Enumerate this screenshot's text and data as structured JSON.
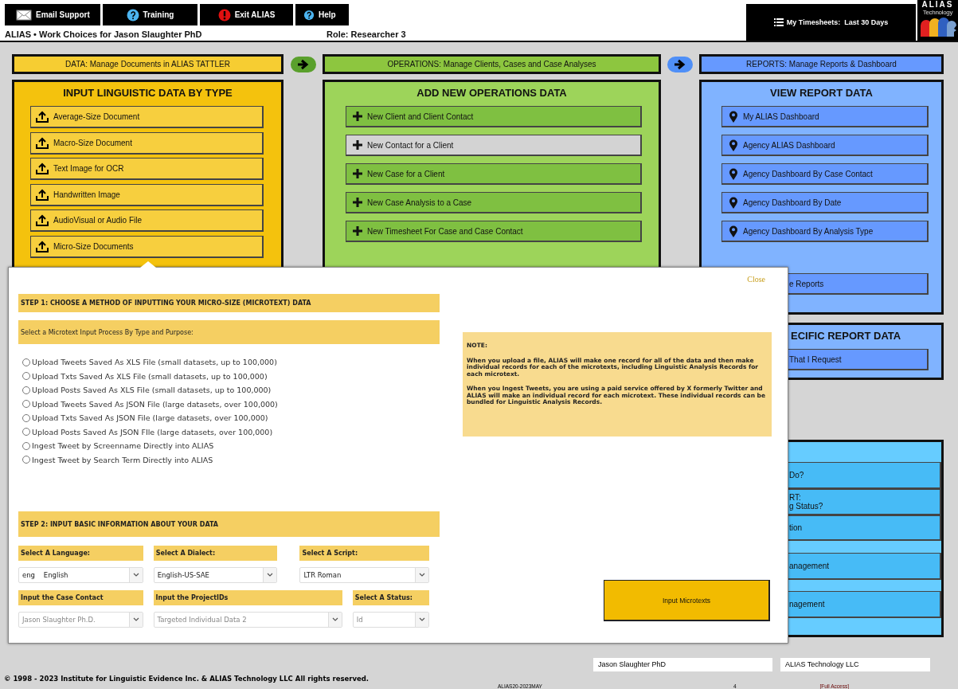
{
  "top_nav": [
    {
      "label": "Email Support",
      "kind": "mail"
    },
    {
      "label": "Training",
      "kind": "question"
    },
    {
      "label": "Exit ALIAS",
      "kind": "alert"
    },
    {
      "label": "Help",
      "kind": "help"
    }
  ],
  "page_title": "ALIAS • Work Choices for Jason Slaughter PhD",
  "role": "Role: Researcher 3",
  "timesheets_button": "My Timesheets:  Last 30 Days",
  "logo": {
    "name": "ALIAS",
    "subtitle": "Technology"
  },
  "columns": [
    {
      "heading": "DATA: Manage Documents in ALIAS TATTLER",
      "color": "#f6cd32",
      "kind": "data",
      "panels": [
        {
          "title": "INPUT LINGUISTIC DATA BY TYPE",
          "color": "#f4c20d",
          "buttons": [
            {
              "label": "Average-Size Document",
              "selected": false
            },
            {
              "label": "Macro-Size Document",
              "selected": false
            },
            {
              "label": "Text Image for OCR",
              "selected": false
            },
            {
              "label": "Handwritten Image",
              "selected": false
            },
            {
              "label": "AudioVisual or Audio File",
              "selected": false
            },
            {
              "label": "Micro-Size Documents",
              "selected": false
            }
          ]
        }
      ]
    },
    {
      "heading": "OPERATIONS: Manage Clients, Cases and Case Analyses",
      "color": "#8dc63f",
      "kind": "operations",
      "panels": [
        {
          "title": "ADD NEW OPERATIONS DATA",
          "color": "#9dd45a",
          "buttons": [
            {
              "label": "New Client and Client Contact",
              "selected": false
            },
            {
              "label": "New Contact for a Client",
              "selected": true
            },
            {
              "label": "New Case for a Client",
              "selected": false
            },
            {
              "label": "New Case Analysis to a Case",
              "selected": false
            },
            {
              "label": "New Timesheet For Case and Case Contact",
              "selected": false
            }
          ]
        }
      ]
    },
    {
      "heading": "REPORTS: Manage Reports & Dashboard",
      "color": "#6699ff",
      "kind": "reports",
      "panels": [
        {
          "title": "VIEW REPORT DATA",
          "color": "#80b3ff",
          "buttons": [
            {
              "label": "My ALIAS Dashboard",
              "selected": false
            },
            {
              "label": "Agency ALIAS Dashboard",
              "selected": false
            },
            {
              "label": "Agency Dashboard By Case Contact",
              "selected": false
            },
            {
              "label": "Agency Dashboard By Date",
              "selected": false
            },
            {
              "label": "Agency Dashboard By Analysis Type",
              "selected": false
            },
            {
              "label": "e Reports",
              "selected": false
            }
          ]
        },
        {
          "title": "ECIFIC REPORT DATA",
          "color": "#80b3ff",
          "buttons": [
            {
              "label": "That I Request",
              "selected": false
            }
          ]
        },
        {
          "color": "#66ccff",
          "buttons": [
            {
              "label": "Do?",
              "selected": false
            },
            {
              "label": "RT:\ng Status?",
              "selected": false
            },
            {
              "label": "tion",
              "selected": false
            },
            {
              "label": "anagement",
              "selected": false
            },
            {
              "label": "nagement",
              "selected": false
            }
          ]
        }
      ]
    }
  ],
  "modal": {
    "close": "Close",
    "step1_title": "STEP 1: CHOOSE A METHOD OF INPUTTING YOUR MICRO-SIZE (MICROTEXT) DATA",
    "step1_subtitle": "Select a Microtext Input Process By Type and Purpose:",
    "options": [
      {
        "label": "Upload Tweets Saved As XLS File (small datasets, up to 100,000)",
        "selected": false
      },
      {
        "label": "Upload Txts Saved As XLS File (small datasets, up to 100,000)",
        "selected": false
      },
      {
        "label": "Upload Posts Saved As XLS File (small datasets, up to 100,000)",
        "selected": false
      },
      {
        "label": "Upload Tweets Saved As JSON File (large datasets, over 100,000)",
        "selected": false
      },
      {
        "label": "Upload Txts Saved As JSON File (large datasets, over 100,000)",
        "selected": false
      },
      {
        "label": "Upload Posts Saved As JSON FIle (large datasets, over 100,000)",
        "selected": false
      },
      {
        "label": "Ingest Tweet by Screenname Directly into ALIAS",
        "selected": false
      },
      {
        "label": "Ingest Tweet by Search Term Directly into ALIAS",
        "selected": false
      }
    ],
    "note": {
      "heading": "NOTE:",
      "paragraphs": [
        "When you upload a file, ALIAS will make one record for all of the data and then make individual records for each of the microtexts, including Linguistic Analysis Records for each microtext.",
        "When you Ingest Tweets, you are using a paid service offered by X formerly Twitter and ALIAS will make an individual record for each microtext. These individual records can be bundled for Linguistic Analysis Records."
      ]
    },
    "step2_title": "STEP 2: INPUT BASIC INFORMATION ABOUT YOUR DATA",
    "field_rows": [
      [
        {
          "label": "Select A Language:",
          "value": "eng    English",
          "disabled": false
        },
        {
          "label": "Select A Dialect:",
          "value": "English-US-SAE",
          "disabled": false
        },
        {
          "label": "Select A Script:",
          "value": "LTR Roman",
          "disabled": false
        }
      ],
      [
        {
          "label": "Input the Case Contact",
          "value": "Jason Slaughter Ph.D.",
          "disabled": true
        },
        {
          "label": "Input the ProjectIDs",
          "value": "Targeted Individual Data 2",
          "disabled": true
        },
        {
          "label": "Select A Status:",
          "value": "Id",
          "disabled": true
        }
      ]
    ],
    "submit": "Input Microtexts"
  },
  "footer": {
    "user_field": "Jason Slaughter PhD",
    "company_field": "ALIAS Technology LLC",
    "copyright": "© 1998 - 2023 Institute for Linguistic Evidence Inc. & ALIAS Technology LLC All rights reserved.",
    "version": "ALIAS20-2023MAY",
    "count": "4",
    "access": "[Full Access]"
  }
}
